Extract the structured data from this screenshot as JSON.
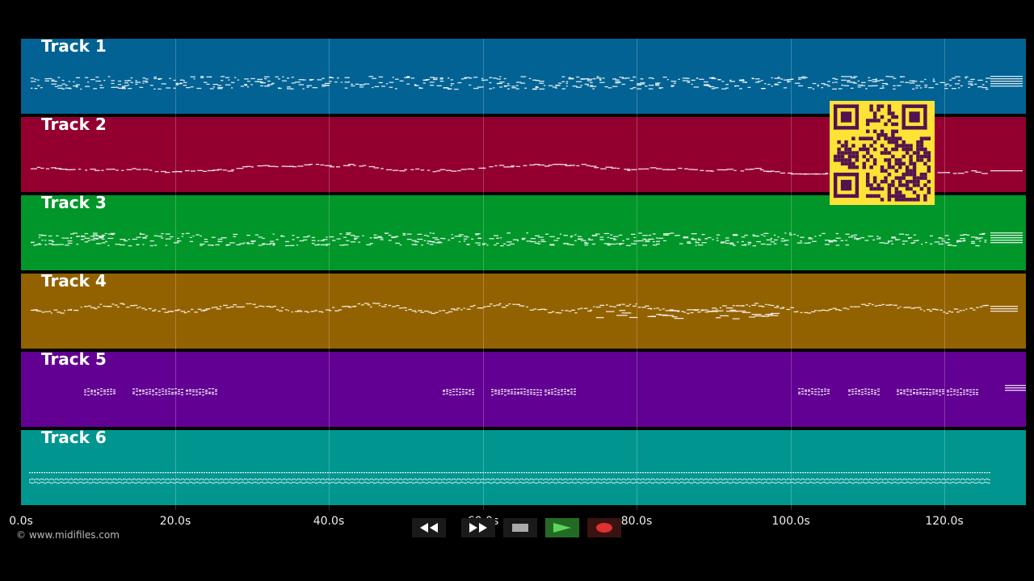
{
  "tracks": [
    {
      "title": "Track 1",
      "color": "#016293",
      "pattern": "dense"
    },
    {
      "title": "Track 2",
      "color": "#930030",
      "pattern": "melody"
    },
    {
      "title": "Track 3",
      "color": "#009629",
      "pattern": "dense"
    },
    {
      "title": "Track 4",
      "color": "#936200",
      "pattern": "wave"
    },
    {
      "title": "Track 5",
      "color": "#620093",
      "pattern": "sparse"
    },
    {
      "title": "Track 6",
      "color": "#00968f",
      "pattern": "lines"
    }
  ],
  "timeline": {
    "ticks": [
      "0.0s",
      "20.0s",
      "40.0s",
      "60.0s",
      "80.0s",
      "100.0s",
      "120.0s"
    ]
  },
  "copyright": "© www.midifiles.com",
  "transport": {
    "buttons": [
      "rewind",
      "fast-forward",
      "stop",
      "play",
      "record"
    ],
    "colors": {
      "stop": "#aaaaaa",
      "play": "#3a9a3a",
      "record": "#e03030"
    }
  },
  "qr_code": {
    "color": "#ffe236",
    "module_color": "#52134f"
  }
}
